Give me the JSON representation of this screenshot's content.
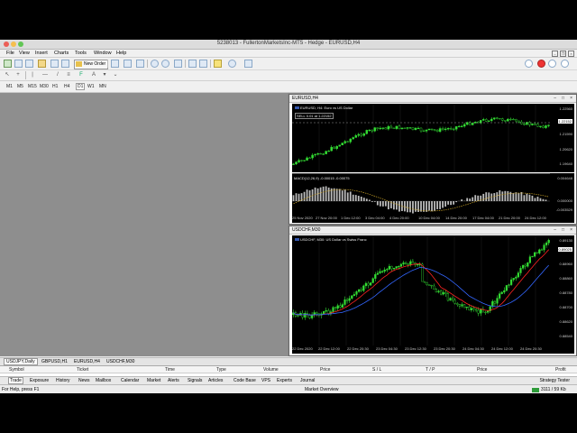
{
  "window": {
    "title": "5238013 - FullertonMarketsInc-MT5 - Hedge - EURUSD,H4"
  },
  "menu": [
    "File",
    "View",
    "Insert",
    "Charts",
    "Tools",
    "Window",
    "Help"
  ],
  "toolbar": {
    "new_order_label": "New Order"
  },
  "timeframes": [
    "M1",
    "M5",
    "M15",
    "M30",
    "H1",
    "H4",
    "D1",
    "W1",
    "MN"
  ],
  "active_timeframe": "D1",
  "charts": [
    {
      "window_title": "EURUSD,H4",
      "legend": "EURUSD, H4: Euro vs US Dollar",
      "sell_label": "SELL 0.01 at 1.22152",
      "indicator_label": "MACD(12,26,9) -0.00015 -0.00075",
      "price_labels": [
        "1.22560",
        "1.22152",
        "1.21590",
        "1.20620",
        "1.19640"
      ],
      "indicator_labels": [
        "0.004648",
        "0.000000",
        "-0.003529"
      ],
      "time_labels": [
        "25 Nov 2020",
        "27 Nov 20:00",
        "1 Dec 12:00",
        "3 Dec 04:00",
        "4 Dec 20:00",
        "10 Dec 04:00",
        "14 Dec 20:00",
        "17 Dec 04:00",
        "21 Dec 20:00",
        "24 Dec 12:00"
      ]
    },
    {
      "window_title": "USDCHF,M30",
      "legend": "USDCHF, M30: US Dollar vs Swiss Franc",
      "price_labels": [
        "0.89130",
        "0.89025",
        "0.88960",
        "0.88860",
        "0.88780",
        "0.88700",
        "0.88620",
        "0.88540"
      ],
      "time_labels": [
        "22 Dec 2020",
        "22 Dec 12:00",
        "22 Dec 20:30",
        "23 Dec 04:30",
        "23 Dec 12:30",
        "23 Dec 20:30",
        "24 Dec 04:30",
        "24 Dec 12:00",
        "24 Dec 20:30"
      ]
    }
  ],
  "chart_tabs": [
    "USDJPY,Daily",
    "GBPUSD,H1",
    "EURUSD,H4",
    "USDCHF,M30"
  ],
  "active_chart_tab": "USDJPY,Daily",
  "terminal": {
    "columns": [
      "Symbol",
      "Ticket",
      "Time",
      "Type",
      "Volume",
      "Price",
      "S / L",
      "T / P",
      "Price",
      "Profit"
    ],
    "tabs": [
      "Trade",
      "Exposure",
      "History",
      "News",
      "Mailbox",
      "Calendar",
      "Market",
      "Alerts",
      "Signals",
      "Articles",
      "Code Base",
      "VPS",
      "Experts",
      "Journal"
    ],
    "active_tab": "Trade",
    "strategy_tester_label": "Strategy Tester"
  },
  "status": {
    "help_text": "For Help, press F1",
    "center_text": "Market Overview",
    "net_text": "3111 / 59 Kb"
  }
}
